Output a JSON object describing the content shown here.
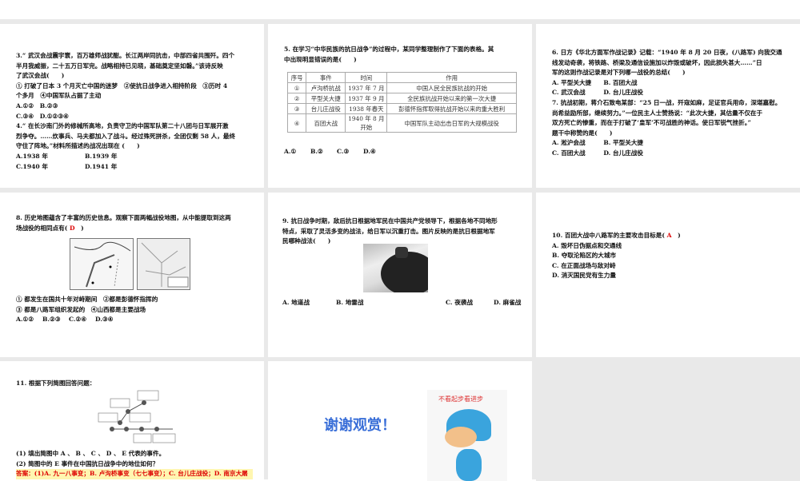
{
  "slides": [
    {
      "lines": [
        "3.“ 武汉会战震宇寰，百万雄师战犹酣。长江两岸同抗击，中部四省共围歼。四个",
        "半月我威振，二十五万日军完。战略相持已见晓，基础奠定坚如磐。”该诗反映",
        "了武汉会战(　　)",
        "① 打破了日本 3 个月灭亡中国的迷梦　②使抗日战争进入相持阶段　③历时 4",
        "个多月　④中国军队占据了主动",
        "A.①②　B.②③",
        "C.③④　D.①②③④",
        "4.“ 在长沙南门外的修械所高地，负责守卫的中国军队第二十八团与日军展开激",
        "烈争夺。……炊事兵、马夫都加入了战斗。经过殊死拼杀，全团仅剩 58 人，最终",
        "守住了阵地。”材料所描述的战况出现在 (　　)"
      ],
      "options": [
        "A.1938 年",
        "B.1939 年",
        "C.1940 年",
        "D.1941 年"
      ]
    },
    {
      "question": [
        "5. 在学习“中华民族的抗日战争”的过程中，某同学整理制作了下面的表格。其",
        "中出现明显错误的是(　　)"
      ],
      "table": {
        "headers": [
          "序号",
          "事件",
          "时间",
          "作用"
        ],
        "rows": [
          [
            "①",
            "卢沟桥抗战",
            "1937 年 7 月",
            "中国人民全民族抗战的开始"
          ],
          [
            "②",
            "平型关大捷",
            "1937 年 9 月",
            "全民族抗战开始以来的第一次大捷"
          ],
          [
            "③",
            "台儿庄战役",
            "1938 年春天",
            "彭德怀指挥取得抗战开始以来的重大胜利"
          ],
          [
            "④",
            "百团大战",
            "1940 年 8 月开始",
            "中国军队主动出击日军的大规模战役"
          ]
        ]
      },
      "options": [
        "A.①",
        "B.②",
        "C.③",
        "D.④"
      ]
    },
    {
      "lines": [
        "6. 日方《华北方面军作战记录》记载：“1940 年 8 月 20 日夜，(八路军) 向我交通",
        "线发动奇袭，将铁路、桥梁及通信设施加以炸毁或破坏，因此损失甚大……”日",
        "军的这则作战记录是对下列哪一战役的总结(　　)",
        "A. 平型关大捷　　B. 百团大战",
        "C. 武汉会战　　　D. 台儿庄战役",
        "7. 抗战初期，蒋介石致电某部：“25 日一战，歼寇如麻，足证官兵用命，深堪嘉慰。",
        "尚希益励所部，继续努力。”一位民主人士赞扬说：“此次大捷，其估量不仅在于",
        "双方死亡的惨重，而在于打破了‘皇军’不可战胜的神话。使日军锐气挫折。”",
        "题干中称赞的是(　　)",
        "A. 淞沪会战　　　B. 平型关大捷",
        "C. 百团大战　　　D. 台儿庄战役"
      ]
    },
    {
      "question": [
        "8. 历史地图蕴含了丰富的历史信息。观察下面两幅战役地图，从中能提取到这两",
        "场战役的相同点有("
      ],
      "answer": "D",
      "statements": [
        "① 都发生在国共十年对峙期间　②都是彭德怀指挥的",
        "③ 都是八路军组织发起的　④山西都是主要战场"
      ],
      "options": [
        "A.①②",
        "B.②③",
        "C.②④",
        "D.③④"
      ]
    },
    {
      "question": [
        "9. 抗日战争时期，敌后抗日根据地军民在中国共产党领导下，根据各地不同地形",
        "特点，采取了灵活多变的战法，给日军以沉重打击。图片反映的是抗日根据地军",
        "民哪种战法(　　)"
      ],
      "options": [
        "A. 地道战",
        "B. 地雷战",
        "C. 夜袭战",
        "D. 麻雀战"
      ]
    },
    {
      "question": "10. 百团大战中八路军的主要攻击目标是(",
      "answer": "A",
      "options": [
        "A. 毁坏日伪据点和交通线",
        "B. 夺取沦陷区的大城市",
        "C. 在正面战场与敌对峙",
        "D. 消灭国民党有生力量"
      ]
    },
    {
      "question": "11. 根据下列简图回答问题：",
      "sub": [
        "(1) 填出简图中 A 、 B 、 C 、 D 、 E 代表的事件。",
        "(2) 简图中的 E 事件在中国抗日战争中的地位如何？"
      ],
      "answer": "答案：(1)A. 九一八事变；B. 卢沟桥事变（七七事变）；C. 台儿庄战役；D. 南京大屠"
    },
    {
      "thanks": "谢谢观赏！",
      "caption": "不看起步看进步"
    }
  ],
  "colors": {
    "answer_red": "#dd0000",
    "thanks_blue": "#3a6fd8",
    "answer_bg": "#fff6b0"
  }
}
